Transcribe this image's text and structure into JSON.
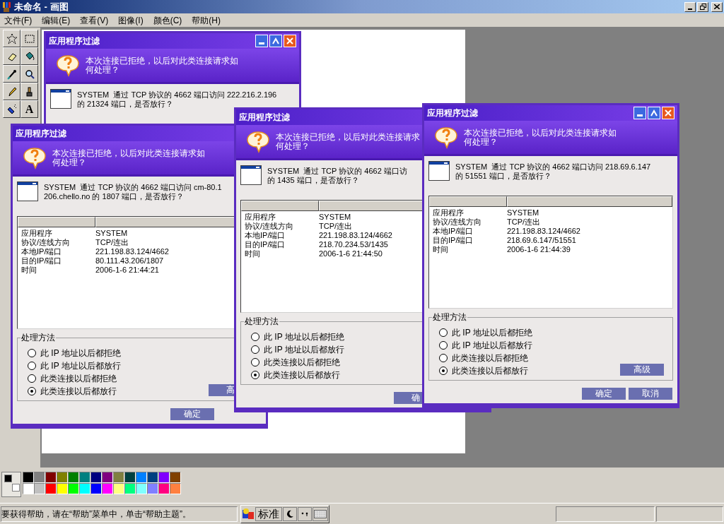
{
  "app": {
    "title": "未命名 - 画图",
    "menu": [
      "文件(F)",
      "编辑(E)",
      "查看(V)",
      "图像(I)",
      "颜色(C)",
      "帮助(H)"
    ]
  },
  "toolbox": {
    "text_tool": "A"
  },
  "dialogs": [
    {
      "title": "应用程序过滤",
      "title_buttons": true,
      "prompt": "本次连接已拒绝，以后对此类连接请求如何处理？",
      "message": "SYSTEM  通过 TCP 协议的 4662 端口访问 222.216.2.196\n的 21324 端口，是否放行？"
    },
    {
      "title": "应用程序过滤",
      "title_buttons": false,
      "prompt": "本次连接已拒绝，以后对此类连接请求如何处理？",
      "message": "SYSTEM  通过 TCP 协议的 4662 端口访问 cm-80.1\n206.chello.no 的 1807 端口，是否放行？",
      "details": [
        {
          "label": "应用程序",
          "value": "SYSTEM"
        },
        {
          "label": "协议/连线方向",
          "value": "TCP/连出"
        },
        {
          "label": "本地IP/端口",
          "value": "221.198.83.124/4662"
        },
        {
          "label": "目的IP/端口",
          "value": "80.111.43.206/1807"
        },
        {
          "label": "时间",
          "value": "2006-1-6 21:44:21"
        }
      ],
      "group": "处理方法",
      "options": [
        {
          "label": "此 IP 地址以后都拒绝",
          "selected": false
        },
        {
          "label": "此 IP 地址以后都放行",
          "selected": false
        },
        {
          "label": "此类连接以后都拒绝",
          "selected": false
        },
        {
          "label": "此类连接以后都放行",
          "selected": true
        }
      ],
      "advanced_button": "高",
      "buttons": [
        "确定"
      ]
    },
    {
      "title": "应用程序过滤",
      "title_buttons": false,
      "prompt": "本次连接已拒绝，以后对此类连接请求何处理？",
      "message": "SYSTEM  通过 TCP 协议的 4662 端口访的 1435 端口，是否放行？",
      "details": [
        {
          "label": "应用程序",
          "value": "SYSTEM"
        },
        {
          "label": "协议/连线方向",
          "value": "TCP/连出"
        },
        {
          "label": "本地IP/端口",
          "value": "221.198.83.124/4662"
        },
        {
          "label": "目的IP/端口",
          "value": "218.70.234.53/1435"
        },
        {
          "label": "时间",
          "value": "2006-1-6 21:44:50"
        }
      ],
      "group": "处理方法",
      "options": [
        {
          "label": "此 IP 地址以后都拒绝",
          "selected": false
        },
        {
          "label": "此 IP 地址以后都放行",
          "selected": false
        },
        {
          "label": "此类连接以后都拒绝",
          "selected": false
        },
        {
          "label": "此类连接以后都放行",
          "selected": true
        }
      ],
      "buttons": [
        "确"
      ]
    },
    {
      "title": "应用程序过滤",
      "title_buttons": true,
      "prompt": "本次连接已拒绝，以后对此类连接请求如何处理？",
      "message": "SYSTEM  通过 TCP 协议的 4662 端口访问 218.69.6.147\n的 51551 端口，是否放行？",
      "details": [
        {
          "label": "应用程序",
          "value": "SYSTEM"
        },
        {
          "label": "协议/连线方向",
          "value": "TCP/连出"
        },
        {
          "label": "本地IP/端口",
          "value": "221.198.83.124/4662"
        },
        {
          "label": "目的IP/端口",
          "value": "218.69.6.147/51551"
        },
        {
          "label": "时间",
          "value": "2006-1-6 21:44:39"
        }
      ],
      "group": "处理方法",
      "options": [
        {
          "label": "此 IP 地址以后都拒绝",
          "selected": false
        },
        {
          "label": "此 IP 地址以后都放行",
          "selected": false
        },
        {
          "label": "此类连接以后都拒绝",
          "selected": false
        },
        {
          "label": "此类连接以后都放行",
          "selected": true
        }
      ],
      "advanced_button": "高级",
      "buttons": [
        "确定",
        "取消"
      ]
    }
  ],
  "palette": {
    "current": [
      {
        "color": "#000000"
      },
      {
        "color": "#ffffff"
      }
    ],
    "colors": [
      {
        "color": "#000000"
      },
      {
        "color": "#808080"
      },
      {
        "color": "#800000"
      },
      {
        "color": "#808000"
      },
      {
        "color": "#008000"
      },
      {
        "color": "#008080"
      },
      {
        "color": "#000080"
      },
      {
        "color": "#800080"
      },
      {
        "color": "#808040"
      },
      {
        "color": "#004040"
      },
      {
        "color": "#0080ff"
      },
      {
        "color": "#004080"
      },
      {
        "color": "#8000ff"
      },
      {
        "color": "#804000"
      },
      {
        "color": "#ffffff"
      },
      {
        "color": "#c0c0c0"
      },
      {
        "color": "#ff0000"
      },
      {
        "color": "#ffff00"
      },
      {
        "color": "#00ff00"
      },
      {
        "color": "#00ffff"
      },
      {
        "color": "#0000ff"
      },
      {
        "color": "#ff00ff"
      },
      {
        "color": "#ffff80"
      },
      {
        "color": "#00ff80"
      },
      {
        "color": "#80ffff"
      },
      {
        "color": "#8080ff"
      },
      {
        "color": "#ff0080"
      },
      {
        "color": "#ff8040"
      }
    ]
  },
  "status_bar": {
    "text": "要获得帮助，请在“帮助”菜单中，单击“帮助主题”。",
    "ime_mode": "标准"
  }
}
